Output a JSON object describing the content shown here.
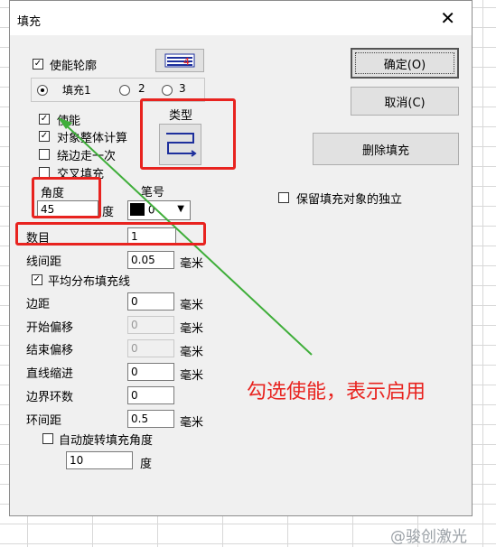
{
  "window": {
    "title": "填充",
    "close_glyph": "✕"
  },
  "outline": {
    "enable_outline": "使能轮廓",
    "checked": true
  },
  "fill_tabs": {
    "options": [
      "填充1",
      "2",
      "3"
    ],
    "selected": 0
  },
  "left": {
    "enable": "使能",
    "whole_calc": "对象整体计算",
    "edge_once": "绕边走一次",
    "cross_fill": "交叉填充",
    "type_label": "类型",
    "angle_label": "角度",
    "angle_value": "45",
    "angle_unit": "度",
    "pen_label": "笔号",
    "pen_value": "0",
    "count_label": "数目",
    "count_value": "1",
    "line_spacing_label": "线间距",
    "line_spacing_value": "0.05",
    "even_dist": "平均分布填充线",
    "margin_label": "边距",
    "margin_value": "0",
    "start_offset_label": "开始偏移",
    "start_offset_value": "0",
    "end_offset_label": "结束偏移",
    "end_offset_value": "0",
    "line_indent_label": "直线缩进",
    "line_indent_value": "0",
    "loop_count_label": "边界环数",
    "loop_count_value": "0",
    "loop_spacing_label": "环间距",
    "loop_spacing_value": "0.5",
    "unit_mm": "毫米",
    "auto_rotate": "自动旋转填充角度",
    "rotate_value": "10",
    "rotate_unit": "度"
  },
  "right": {
    "ok": "确定(O)",
    "cancel": "取消(C)",
    "delete_fill": "删除填充",
    "keep_independent": "保留填充对象的独立"
  },
  "annotation": {
    "text": "勾选使能，表示启用",
    "color": "#e8231f"
  },
  "watermark": "@骏创激光"
}
